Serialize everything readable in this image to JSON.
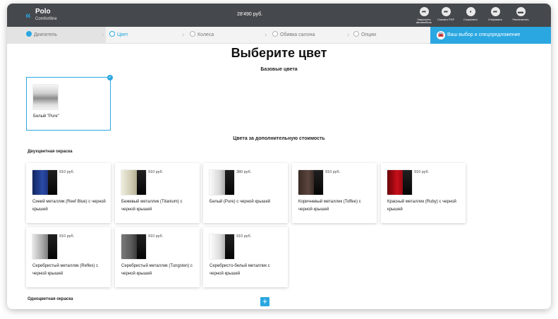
{
  "header": {
    "model": "Polo",
    "trim": "Comfortline",
    "price": "28'490 руб.",
    "actions": [
      {
        "label": "Запросить автомобиль",
        "icon": "share-arrow-icon"
      },
      {
        "label": "Скачать PDF",
        "icon": "download-arrow-icon"
      },
      {
        "label": "Сохранить",
        "icon": "save-icon"
      },
      {
        "label": "Отправить",
        "icon": "send-arrow-icon"
      },
      {
        "label": "Распечатать",
        "icon": "print-icon"
      }
    ]
  },
  "steps": [
    {
      "label": "Двигатель",
      "state": "done"
    },
    {
      "label": "Цвет",
      "state": "active"
    },
    {
      "label": "Колеса",
      "state": "pending"
    },
    {
      "label": "Обивка салона",
      "state": "pending"
    },
    {
      "label": "Опции",
      "state": "pending"
    }
  ],
  "summary_step": "Ваш выбор и спецпредложение",
  "page_title": "Выберите цвет",
  "base_section": {
    "title": "Базовые цвета",
    "colors": [
      {
        "name": "Белый \"Pure\"",
        "selected": true
      }
    ]
  },
  "extra_section": {
    "title": "Цвета за дополнительную стоимость",
    "two_tone": {
      "title": "Двухцветная окраска",
      "colors": [
        {
          "name": "Синий металлик (Reef Blue) с черной крышей",
          "price": "910 руб."
        },
        {
          "name": "Бежевый металлик (Titanium) с черной крышей",
          "price": "910 руб."
        },
        {
          "name": "Белый (Pure) с черной крышей",
          "price": "380 руб."
        },
        {
          "name": "Коричневый металлик (Toffee) с черной крышей",
          "price": "910 руб."
        },
        {
          "name": "Красный металлик (Ruby) с черной крышей",
          "price": "910 руб."
        },
        {
          "name": "Серебристый металлик (Reflex) с черной крышей",
          "price": "910 руб."
        },
        {
          "name": "Серебристый металлик (Tungsten) с черной крышей",
          "price": "910 руб."
        },
        {
          "name": "Серебристо-белый металлик с черной крышей",
          "price": "910 руб."
        }
      ]
    },
    "mono": {
      "title": "Одноцветная окраска"
    }
  },
  "colors": {
    "accent": "#2aa7e1",
    "header_bg": "#45484c",
    "steps_bg": "#f3f3f3"
  }
}
